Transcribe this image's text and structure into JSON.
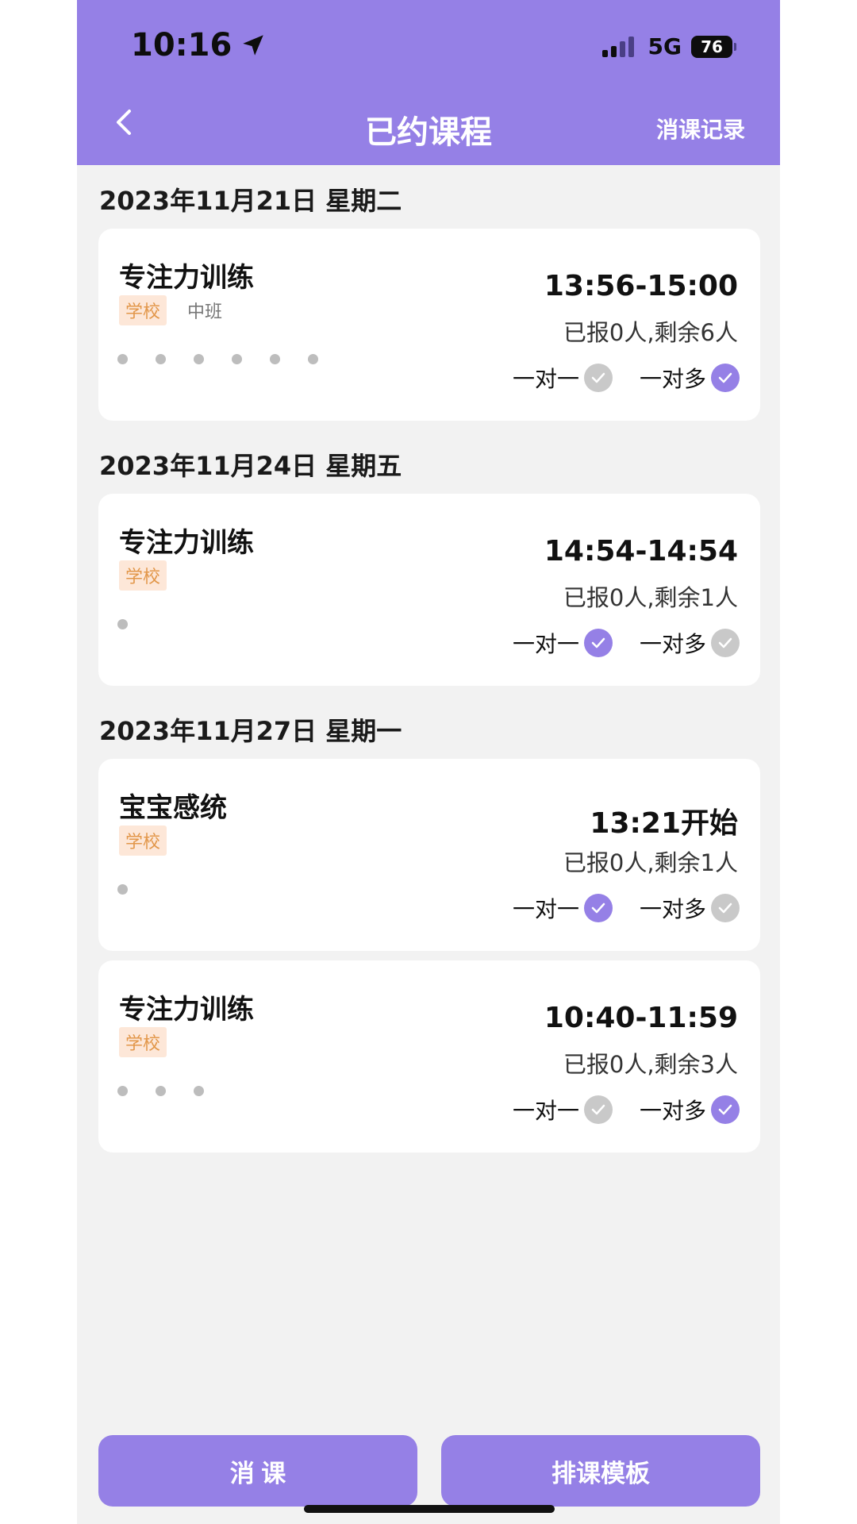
{
  "status_bar": {
    "time": "10:16",
    "network": "5G",
    "battery": "76"
  },
  "header": {
    "title": "已约课程",
    "right_link": "消课记录"
  },
  "sections": [
    {
      "date": "2023年11月21日  星期二",
      "cards": [
        {
          "name": "专注力训练",
          "tag": "学校",
          "sub": "中班",
          "dots": 6,
          "time": "13:56-15:00",
          "count": "已报0人,剩余6人",
          "mode_one": "一对一",
          "mode_one_checked": false,
          "mode_multi": "一对多",
          "mode_multi_checked": true
        }
      ]
    },
    {
      "date": "2023年11月24日  星期五",
      "cards": [
        {
          "name": "专注力训练",
          "tag": "学校",
          "sub": "",
          "dots": 1,
          "time": "14:54-14:54",
          "count": "已报0人,剩余1人",
          "mode_one": "一对一",
          "mode_one_checked": true,
          "mode_multi": "一对多",
          "mode_multi_checked": false
        }
      ]
    },
    {
      "date": "2023年11月27日  星期一",
      "cards": [
        {
          "name": "宝宝感统",
          "tag": "学校",
          "sub": "",
          "dots": 1,
          "time": "13:21开始",
          "count": "已报0人,剩余1人",
          "mode_one": "一对一",
          "mode_one_checked": true,
          "mode_multi": "一对多",
          "mode_multi_checked": false
        },
        {
          "name": "专注力训练",
          "tag": "学校",
          "sub": "",
          "dots": 3,
          "time": "10:40-11:59",
          "count": "已报0人,剩余3人",
          "mode_one": "一对一",
          "mode_one_checked": false,
          "mode_multi": "一对多",
          "mode_multi_checked": true
        }
      ]
    }
  ],
  "footer": {
    "cancel_label": "消 课",
    "template_label": "排课模板"
  },
  "colors": {
    "accent": "#9580e6",
    "tag_bg": "#fde7d8",
    "tag_text": "#e2974a",
    "check_off": "#c9c9c9"
  }
}
